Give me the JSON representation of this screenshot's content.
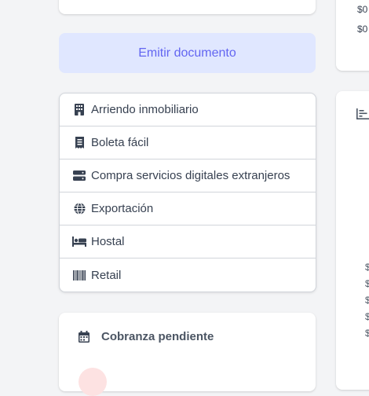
{
  "emit_button": {
    "label": "Emitir documento"
  },
  "documents": [
    {
      "label": "Arriendo inmobiliario",
      "icon": "building-icon"
    },
    {
      "label": "Boleta fácil",
      "icon": "receipt-icon"
    },
    {
      "label": "Compra servicios digitales extranjeros",
      "icon": "server-icon"
    },
    {
      "label": "Exportación",
      "icon": "globe-icon"
    },
    {
      "label": "Hostal",
      "icon": "bed-icon"
    },
    {
      "label": "Retail",
      "icon": "barcode-icon"
    }
  ],
  "cobranza": {
    "title": "Cobranza pendiente",
    "icon": "calendar-icon"
  },
  "right_panel": {
    "amounts": [
      "$0",
      "$0"
    ],
    "chart_icon": "chart-bar-icon",
    "axis_ticks": [
      "$",
      "$",
      "$",
      "$",
      "$"
    ]
  },
  "colors": {
    "accent": "#6366f1",
    "accent_bg": "#e0e7ff",
    "page_bg": "#f3f4f6"
  }
}
